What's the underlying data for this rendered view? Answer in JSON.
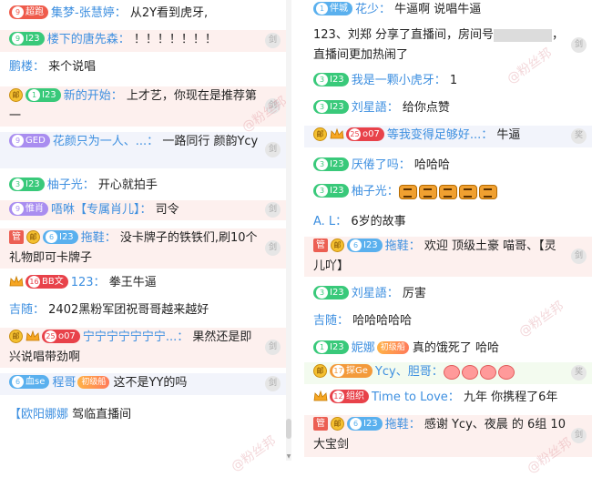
{
  "left": {
    "rows": [
      {
        "badge": "超跑",
        "badge_lv": "9",
        "badge_color": "red",
        "nick": "集梦-张慧婷：",
        "text": "从2Y看到虎牙,"
      },
      {
        "badge": "I23",
        "badge_lv": "9",
        "badge_color": "green",
        "nick": "楼下的唐先森：",
        "text": "！！！！！！！",
        "action": "剑"
      },
      {
        "nick": "鹏楼：",
        "text": "来个说唱"
      },
      {
        "coin": "邮",
        "badge": "I23",
        "badge_lv": "1",
        "badge_color": "green",
        "nick": "新的开始：",
        "text": "上才艺，你现在是推荐第一",
        "action": "剑"
      },
      {
        "badge": "GED",
        "badge_lv": "9",
        "badge_color": "purple",
        "nick": "花颜只为一人、...：",
        "text": "一路同行  颜韵Ycy",
        "action": "剑"
      },
      {
        "badge": "I23",
        "badge_lv": "3",
        "badge_color": "green",
        "nick": "柚子光：",
        "text": "开心就拍手"
      },
      {
        "badge": "惟肖",
        "badge_lv": "9",
        "badge_color": "purple",
        "nick": "唔咻【专属肖儿】：",
        "text": "司令",
        "action": "剑"
      },
      {
        "manager": "管",
        "coin": "邮",
        "badge": "I23",
        "badge_lv": "6",
        "badge_color": "blue",
        "nick": "拖鞋：",
        "text": "没卡牌子的铁铁们,刷10个礼物即可卡牌子",
        "action": "剑"
      },
      {
        "level_tag": "BB文",
        "level_num": "16",
        "nick": "123：",
        "text": "拳王牛逼"
      },
      {
        "nick": "吉随：",
        "text": "2402黑粉军团祝哥哥越来越好"
      },
      {
        "coin": "邮",
        "level_tag": "o07",
        "level_num": "25",
        "nick": "宁宁宁宁宁宁宁...：",
        "text": "果然还是即兴说唱带劲啊",
        "action": "剑"
      },
      {
        "badge": "血se",
        "badge_lv": "6",
        "badge_color": "blue",
        "nick": "程哥",
        "pill": "初级船",
        "text": "这不是YY的吗",
        "action": "剑"
      },
      {
        "nick": "【欧阳娜娜",
        "text": "驾临直播间"
      }
    ]
  },
  "right": {
    "rows": [
      {
        "badge": "伴城",
        "badge_lv": "1",
        "badge_color": "blue",
        "nick": "花少：",
        "text": "牛逼啊  说唱牛逼"
      },
      {
        "sys_pre": "123、刘郑 分享了直播间，房间号",
        "sys_post": "，直播间更加热闹了",
        "action": "剑"
      },
      {
        "badge": "I23",
        "badge_lv": "3",
        "badge_color": "green",
        "nick": "我是一颗小虎牙：",
        "text": "1"
      },
      {
        "badge": "I23",
        "badge_lv": "3",
        "badge_color": "green",
        "nick": "刘星語：",
        "text": "给你点赞"
      },
      {
        "coin": "邮",
        "level_tag": "o07",
        "level_num": "25",
        "nick": "等我变得足够好...：",
        "text": "牛逼",
        "action": "奖"
      },
      {
        "badge": "I23",
        "badge_lv": "3",
        "badge_color": "green",
        "nick": "厌倦了吗：",
        "text": "哈哈哈"
      },
      {
        "badge": "I23",
        "badge_lv": "3",
        "badge_color": "green",
        "nick": "柚子光：",
        "gifts": 5
      },
      {
        "nick": "A. L：",
        "text": "6岁的故事"
      },
      {
        "manager": "管",
        "coin": "邮",
        "badge": "I23",
        "badge_lv": "6",
        "badge_color": "blue",
        "nick": "拖鞋：",
        "text": "欢迎  顶级土豪 喵哥、【灵儿吖】",
        "action": "剑"
      },
      {
        "badge": "I23",
        "badge_lv": "3",
        "badge_color": "green",
        "nick": "刘星語：",
        "text": "厉害"
      },
      {
        "nick": "吉随：",
        "text": "哈哈哈哈哈"
      },
      {
        "badge": "I23",
        "badge_lv": "1",
        "badge_color": "green",
        "nick": "妮娜",
        "pill": "初级船",
        "text": "真的饿死了  哈哈"
      },
      {
        "coin": "邮",
        "badge": "探Ge",
        "badge_lv": "17",
        "badge_color": "orange",
        "nick": "Ycy、胆哥：",
        "bags": 4,
        "action": "奖"
      },
      {
        "level_tag": "组织",
        "level_num": "12",
        "nick": "Time to Love：",
        "text": "九年  你携程了6年"
      },
      {
        "manager": "管",
        "coin": "邮",
        "badge": "I23",
        "badge_lv": "6",
        "badge_color": "blue",
        "nick": "拖鞋：",
        "text": "感谢 Ycy、夜晨 的 6组 10大宝剑",
        "action": "剑"
      }
    ]
  },
  "watermark": "@粉丝邦",
  "colors": {
    "nick": "#3d8fe0",
    "pink_row": "#fdf0ee",
    "green_badge": "#39c97a",
    "blue_badge": "#5ab0ee"
  }
}
